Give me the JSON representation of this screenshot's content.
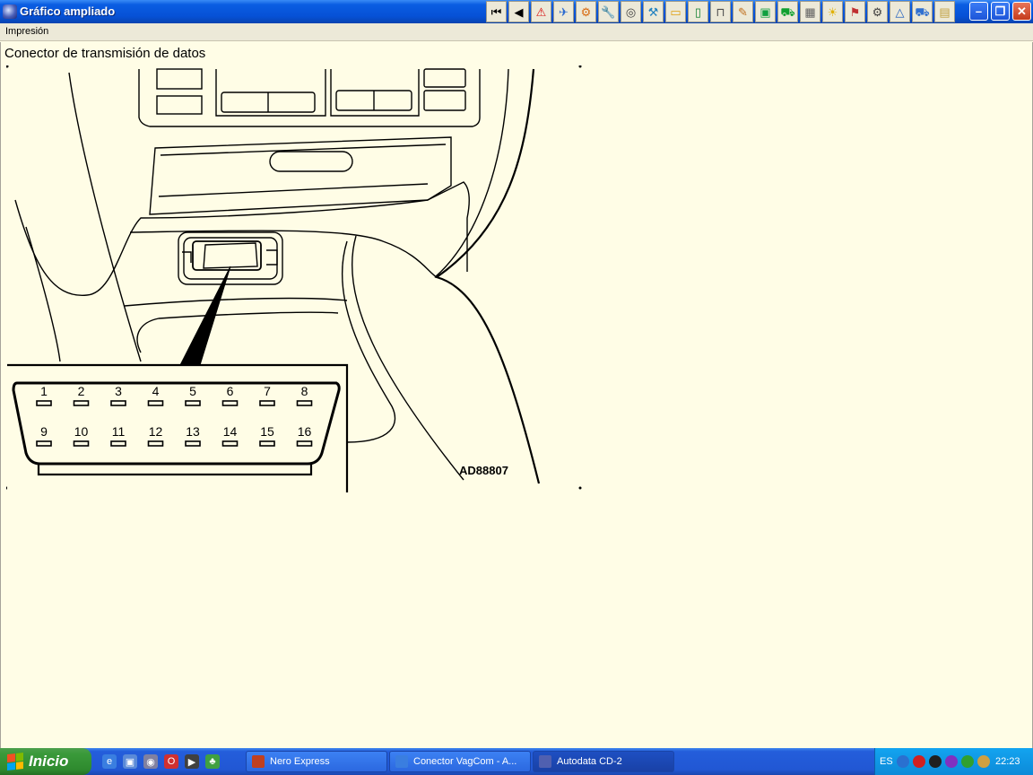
{
  "window": {
    "title": "Gráfico ampliado",
    "minimize_glyph": "–",
    "maximize_glyph": "❐",
    "close_glyph": "✕"
  },
  "toolbar": {
    "buttons": [
      {
        "name": "first-page-icon",
        "glyph": "⏮",
        "color": "#000000"
      },
      {
        "name": "previous-icon",
        "glyph": "◀",
        "color": "#000000"
      },
      {
        "name": "warning-icon",
        "glyph": "⚠",
        "color": "#d81010"
      },
      {
        "name": "airplane-icon",
        "glyph": "✈",
        "color": "#2a6ad0"
      },
      {
        "name": "gear-icon",
        "glyph": "⚙",
        "color": "#d86a10"
      },
      {
        "name": "wrench-icon",
        "glyph": "🔧",
        "color": "#b08010"
      },
      {
        "name": "tire-icon",
        "glyph": "◎",
        "color": "#404040"
      },
      {
        "name": "tools-icon",
        "glyph": "⚒",
        "color": "#2080c0"
      },
      {
        "name": "battery-icon",
        "glyph": "▭",
        "color": "#e0a010"
      },
      {
        "name": "door-icon",
        "glyph": "▯",
        "color": "#108030"
      },
      {
        "name": "lift-icon",
        "glyph": "⊓",
        "color": "#505050"
      },
      {
        "name": "pen-icon",
        "glyph": "✎",
        "color": "#c07020"
      },
      {
        "name": "engine-icon",
        "glyph": "▣",
        "color": "#10a040"
      },
      {
        "name": "car-green-icon",
        "glyph": "⛟",
        "color": "#10a030"
      },
      {
        "name": "chip-icon",
        "glyph": "▦",
        "color": "#606060"
      },
      {
        "name": "light-icon",
        "glyph": "☀",
        "color": "#e0b000"
      },
      {
        "name": "service-icon",
        "glyph": "⚑",
        "color": "#c03030"
      },
      {
        "name": "settings-icon",
        "glyph": "⚙",
        "color": "#404040"
      },
      {
        "name": "triangle-icon",
        "glyph": "△",
        "color": "#2060c0"
      },
      {
        "name": "car-blue-icon",
        "glyph": "⛟",
        "color": "#3070d0"
      },
      {
        "name": "note-icon",
        "glyph": "▤",
        "color": "#c0a040"
      }
    ]
  },
  "menu": {
    "items": [
      "Impresión"
    ]
  },
  "content": {
    "heading": "Conector de transmisión de datos",
    "figure_code": "AD88807",
    "pins_top": [
      "1",
      "2",
      "3",
      "4",
      "5",
      "6",
      "7",
      "8"
    ],
    "pins_bottom": [
      "9",
      "10",
      "11",
      "12",
      "13",
      "14",
      "15",
      "16"
    ]
  },
  "taskbar": {
    "start_label": "Inicio",
    "quick_launch": [
      {
        "name": "ie-icon",
        "glyph": "e",
        "color": "#3a7ee0"
      },
      {
        "name": "desktop-icon",
        "glyph": "▣",
        "color": "#5a8ad8"
      },
      {
        "name": "program-icon",
        "glyph": "◉",
        "color": "#8080a0"
      },
      {
        "name": "opera-icon",
        "glyph": "O",
        "color": "#d03030"
      },
      {
        "name": "media-icon",
        "glyph": "▶",
        "color": "#404040"
      },
      {
        "name": "messenger-icon",
        "glyph": "♣",
        "color": "#40a040"
      }
    ],
    "tasks": [
      {
        "label": "Nero Express",
        "icon_color": "#c04020",
        "active": false
      },
      {
        "label": "Conector VagCom - A...",
        "icon_color": "#3a7ee0",
        "active": false
      },
      {
        "label": "Autodata CD-2",
        "icon_color": "#5060b0",
        "active": true
      }
    ],
    "tray": {
      "lang": "ES",
      "icons": [
        {
          "name": "chevron-left-icon",
          "color": "#2a70d0"
        },
        {
          "name": "antivirus-icon",
          "color": "#d02020"
        },
        {
          "name": "zonealarm-icon",
          "color": "#202020"
        },
        {
          "name": "shield-icon",
          "color": "#8030c0"
        },
        {
          "name": "network-icon",
          "color": "#30a030"
        },
        {
          "name": "user-icon",
          "color": "#d0a040"
        }
      ],
      "clock": "22:23"
    }
  }
}
